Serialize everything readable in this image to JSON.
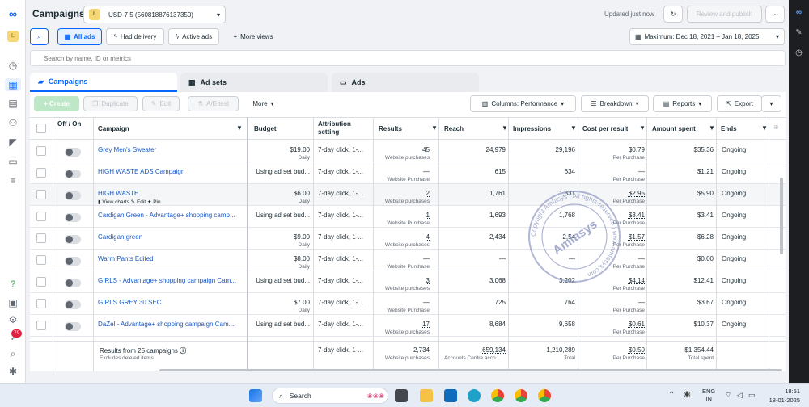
{
  "rail": {
    "icons": [
      "meta-logo",
      "avatar",
      "dashboard-icon",
      "campaigns-table-icon",
      "pages-icon",
      "audiences-icon",
      "megaphone-icon",
      "billing-icon",
      "menu-icon",
      "help-icon",
      "notes-icon",
      "settings-icon",
      "notifications-icon",
      "search-icon",
      "bug-icon"
    ],
    "avatar_letter": "L",
    "notif_badge": "79"
  },
  "rightbar": {
    "icons": [
      "meta-logo",
      "edit-icon",
      "clock-icon"
    ]
  },
  "header": {
    "title": "Campaigns",
    "account_badge": "L",
    "account_name": "USD-7 5 (560818876137350)",
    "updated": "Updated just now",
    "review_label": "Review and publish",
    "more_label": "···"
  },
  "filters": {
    "all_ads": "All ads",
    "had_delivery": "Had delivery",
    "active_ads": "Active ads",
    "more_views": "More views",
    "date_range": "Maximum: Dec 18, 2021 – Jan 18, 2025"
  },
  "search": {
    "placeholder": "Search by name, ID or metrics"
  },
  "tabs": {
    "campaigns": "Campaigns",
    "ad_sets": "Ad sets",
    "ads": "Ads"
  },
  "toolbar": {
    "create": "+ Create",
    "duplicate": "Duplicate",
    "edit": "Edit",
    "ab_test": "A/B test",
    "more": "More",
    "columns": "Columns: Performance",
    "breakdown": "Breakdown",
    "reports": "Reports",
    "export": "Export"
  },
  "columns": {
    "offon": "Off / On",
    "campaign": "Campaign",
    "budget": "Budget",
    "attribution": "Attribution setting",
    "results": "Results",
    "reach": "Reach",
    "impressions": "Impressions",
    "cpr": "Cost per result",
    "spent": "Amount spent",
    "ends": "Ends"
  },
  "rows": [
    {
      "name": "Grey Men's Sweater",
      "budget": "$19.00",
      "budget_sub": "Daily",
      "attr": "7-day click, 1-...",
      "results": "45",
      "results_sub": "Website purchases",
      "reach": "24,979",
      "impr": "29,196",
      "cpr": "$0.79",
      "cpr_sub": "Per Purchase",
      "spent": "$35.36",
      "ends": "Ongoing"
    },
    {
      "name": "HIGH WASTE ADS Campaign",
      "budget": "Using ad set bud...",
      "budget_sub": "",
      "attr": "7-day click, 1-...",
      "results": "—",
      "results_sub": "Website Purchase",
      "reach": "615",
      "impr": "634",
      "cpr": "—",
      "cpr_sub": "Per Purchase",
      "spent": "$1.21",
      "ends": "Ongoing"
    },
    {
      "name": "HIGH WASTE",
      "budget": "$6.00",
      "budget_sub": "Daily",
      "attr": "7-day click, 1-...",
      "results": "2",
      "results_sub": "Website purchases",
      "reach": "1,761",
      "impr": "1,831",
      "cpr": "$2.95",
      "cpr_sub": "Per Purchase",
      "spent": "$5.90",
      "ends": "Ongoing"
    },
    {
      "name": "Cardigan Green - Advantage+ shopping camp...",
      "budget": "Using ad set bud...",
      "budget_sub": "",
      "attr": "7-day click, 1-...",
      "results": "1",
      "results_sub": "Website Purchase",
      "reach": "1,693",
      "impr": "1,768",
      "cpr": "$3.41",
      "cpr_sub": "Per Purchase",
      "spent": "$3.41",
      "ends": "Ongoing"
    },
    {
      "name": "Cardigan green",
      "budget": "$9.00",
      "budget_sub": "Daily",
      "attr": "7-day click, 1-...",
      "results": "4",
      "results_sub": "Website purchases",
      "reach": "2,434",
      "impr": "2,54",
      "cpr": "$1.57",
      "cpr_sub": "Per Purchase",
      "spent": "$6.28",
      "ends": "Ongoing"
    },
    {
      "name": "Warm Pants Edited",
      "budget": "$8.00",
      "budget_sub": "Daily",
      "attr": "7-day click, 1-...",
      "results": "—",
      "results_sub": "Website Purchase",
      "reach": "—",
      "impr": "—",
      "cpr": "—",
      "cpr_sub": "Per Purchase",
      "spent": "$0.00",
      "ends": "Ongoing"
    },
    {
      "name": "GIRLS - Advantage+ shopping campaign Cam...",
      "budget": "Using ad set bud...",
      "budget_sub": "",
      "attr": "7-day click, 1-...",
      "results": "3",
      "results_sub": "Website purchases",
      "reach": "3,068",
      "impr": "3,202",
      "cpr": "$4.14",
      "cpr_sub": "Per Purchase",
      "spent": "$12.41",
      "ends": "Ongoing"
    },
    {
      "name": "GIRLS GREY 30 SEC",
      "budget": "$7.00",
      "budget_sub": "Daily",
      "attr": "7-day click, 1-...",
      "results": "—",
      "results_sub": "Website Purchase",
      "reach": "725",
      "impr": "764",
      "cpr": "—",
      "cpr_sub": "Per Purchase",
      "spent": "$3.67",
      "ends": "Ongoing"
    },
    {
      "name": "DaZel - Advantage+ shopping campaign Cam...",
      "budget": "Using ad set bud...",
      "budget_sub": "",
      "attr": "7-day click, 1-...",
      "results": "17",
      "results_sub": "Website purchases",
      "reach": "8,684",
      "impr": "9,658",
      "cpr": "$0.61",
      "cpr_sub": "Per Purchase",
      "spent": "$10.37",
      "ends": "Ongoing"
    }
  ],
  "row_actions": {
    "view_charts": "View charts",
    "edit": "Edit",
    "pin": "Pin"
  },
  "totals": {
    "label": "Results from 25 campaigns",
    "sub": "Excludes deleted items",
    "attr": "7-day click, 1-...",
    "results": "2,734",
    "results_sub": "Website purchases",
    "reach": "659,134",
    "reach_sub": "Accounts Centre acco...",
    "impr": "1,210,289",
    "impr_sub": "Total",
    "cpr": "$0.50",
    "cpr_sub": "Per Purchase",
    "spent": "$1,354.44",
    "spent_sub": "Total spent"
  },
  "watermark": {
    "line1": "Copyright Amfasys | All rights reserved | www.amfasys.com",
    "center": "Amfasys"
  },
  "taskbar": {
    "search": "Search",
    "lang1": "ENG",
    "lang2": "IN",
    "time": "18:51",
    "date": "18-01-2025"
  }
}
